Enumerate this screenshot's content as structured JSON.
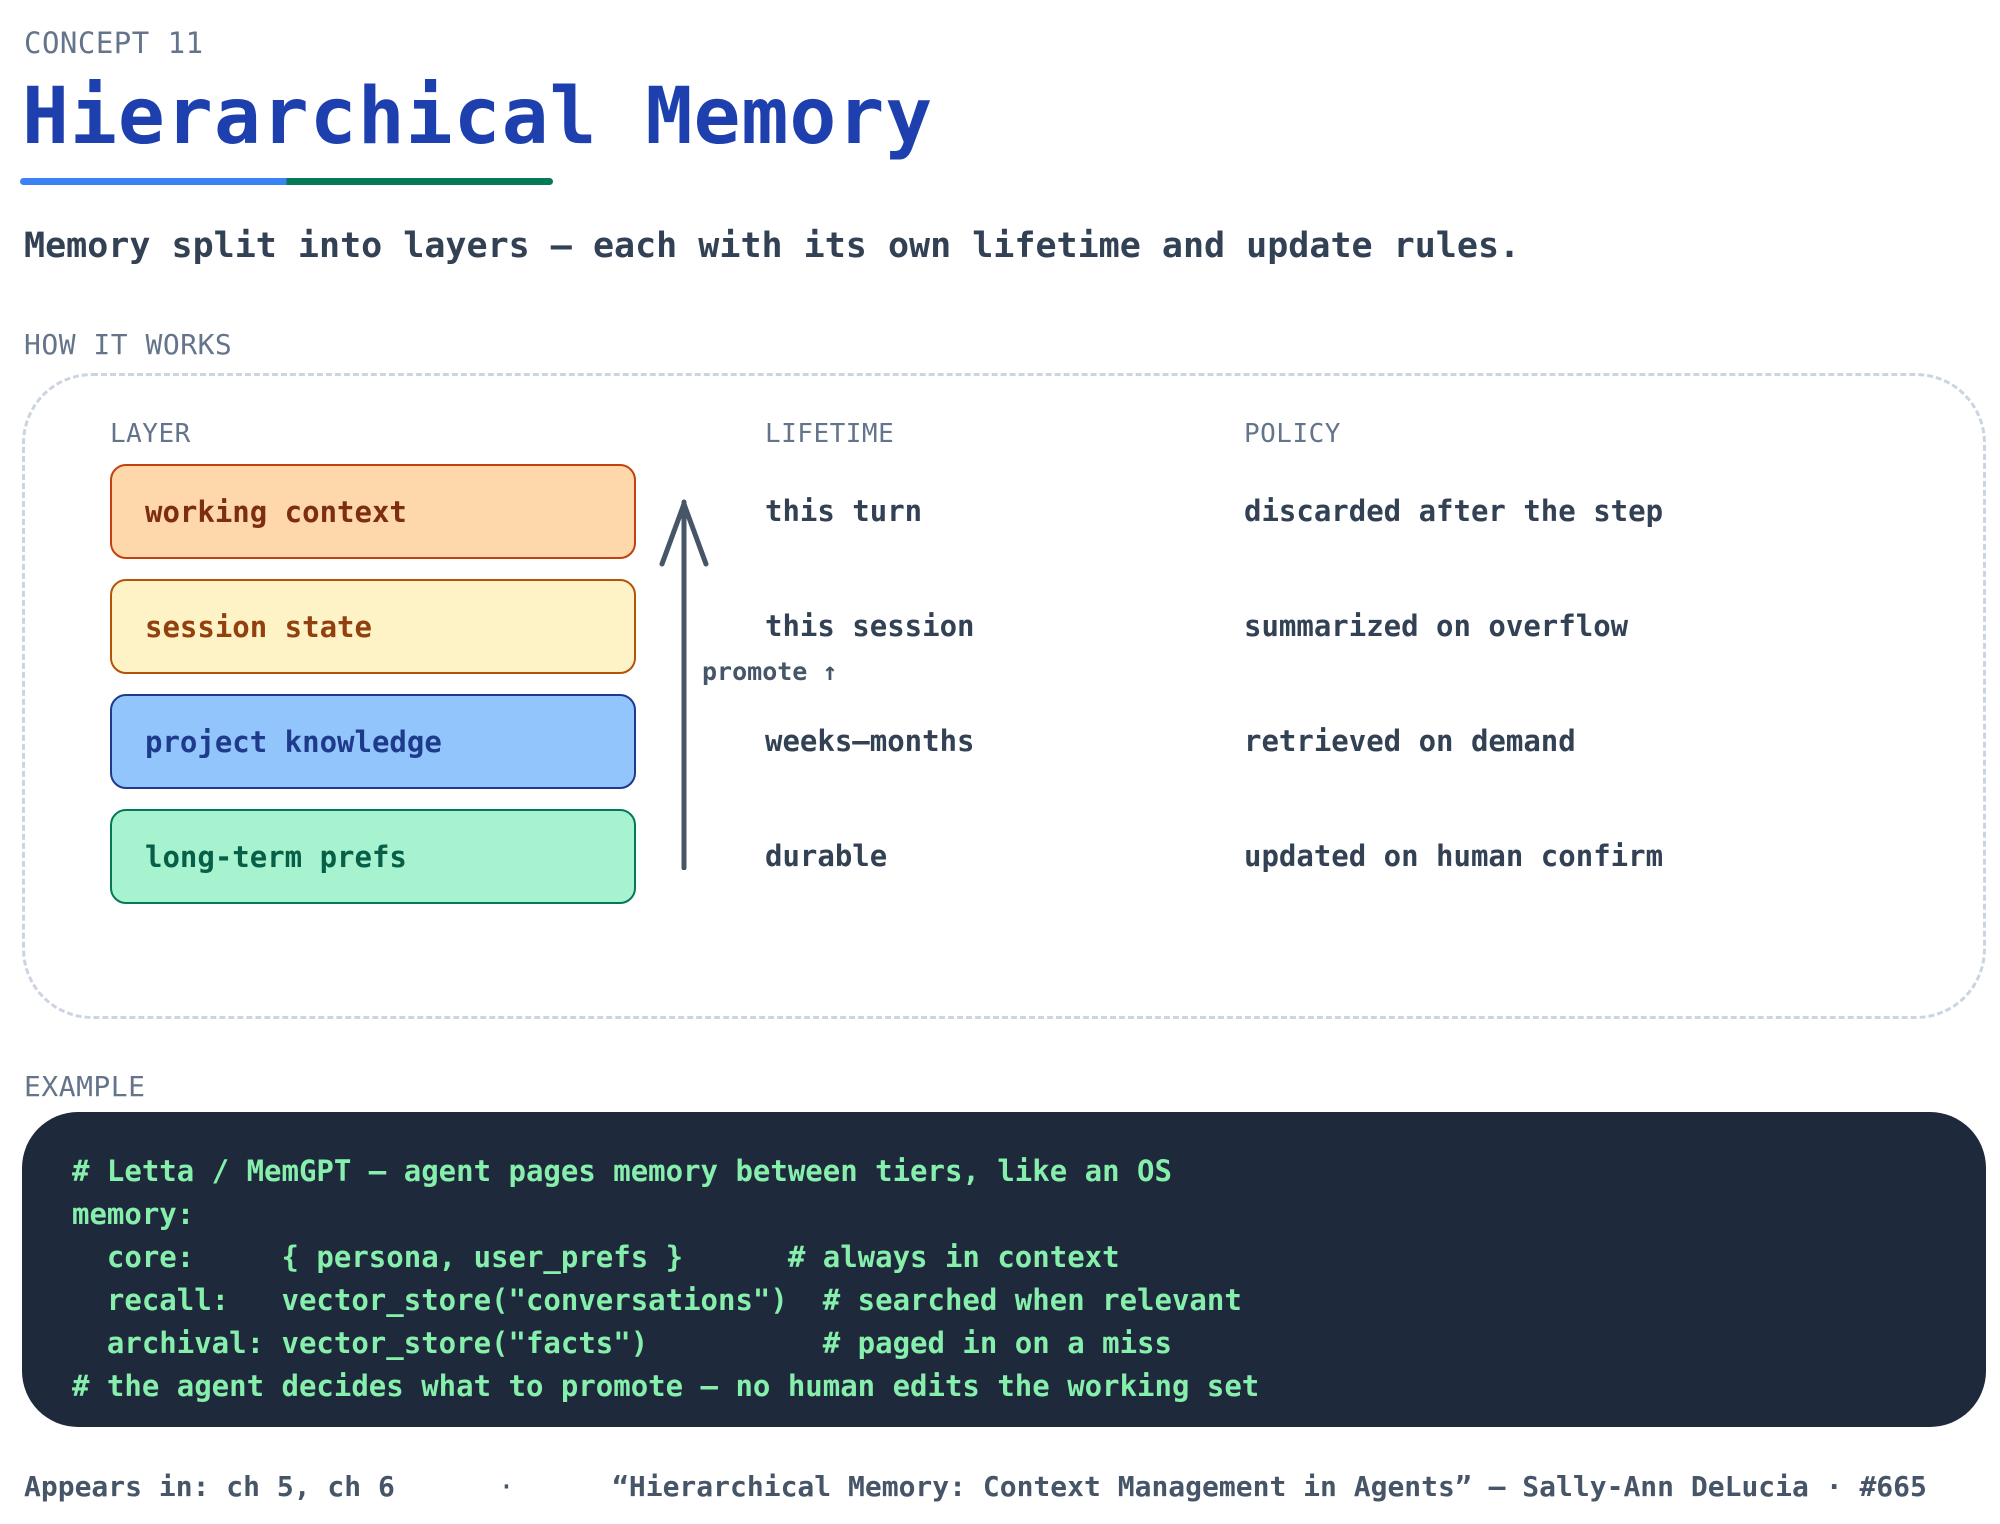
{
  "header": {
    "concept_label": "CONCEPT 11",
    "title": "Hierarchical Memory",
    "subtitle": "Memory split into layers — each with its own lifetime and update rules."
  },
  "how_it_works": {
    "section_label": "HOW IT WORKS",
    "columns": {
      "layer": "LAYER",
      "lifetime": "LIFETIME",
      "policy": "POLICY"
    },
    "layers": [
      {
        "name": "working context",
        "lifetime": "this turn",
        "policy": "discarded after the step",
        "color": "#fed7aa"
      },
      {
        "name": "session state",
        "lifetime": "this session",
        "policy": "summarized on overflow",
        "color": "#fef3c7"
      },
      {
        "name": "project knowledge",
        "lifetime": "weeks–months",
        "policy": "retrieved on demand",
        "color": "#93c5fd"
      },
      {
        "name": "long-term prefs",
        "lifetime": "durable",
        "policy": "updated on human confirm",
        "color": "#a7f3d0"
      }
    ],
    "arrow_label": "promote ↑"
  },
  "example": {
    "section_label": "EXAMPLE",
    "code_lines": [
      "# Letta / MemGPT — agent pages memory between tiers, like an OS",
      "memory:",
      "  core:     { persona, user_prefs }      # always in context",
      "  recall:   vector_store(\"conversations\")  # searched when relevant",
      "  archival: vector_store(\"facts\")          # paged in on a miss",
      "# the agent decides what to promote — no human edits the working set"
    ]
  },
  "footer": {
    "appears_in": "Appears in: ch 5, ch 6",
    "separator": "·",
    "citation": "“Hierarchical Memory: Context Management in Agents” — Sally-Ann DeLucia · #665"
  },
  "colors": {
    "title": "#1e40af",
    "underline_left": "#3b82f6",
    "underline_right": "#047857",
    "code_bg": "#1e293b",
    "code_text": "#86efac"
  }
}
